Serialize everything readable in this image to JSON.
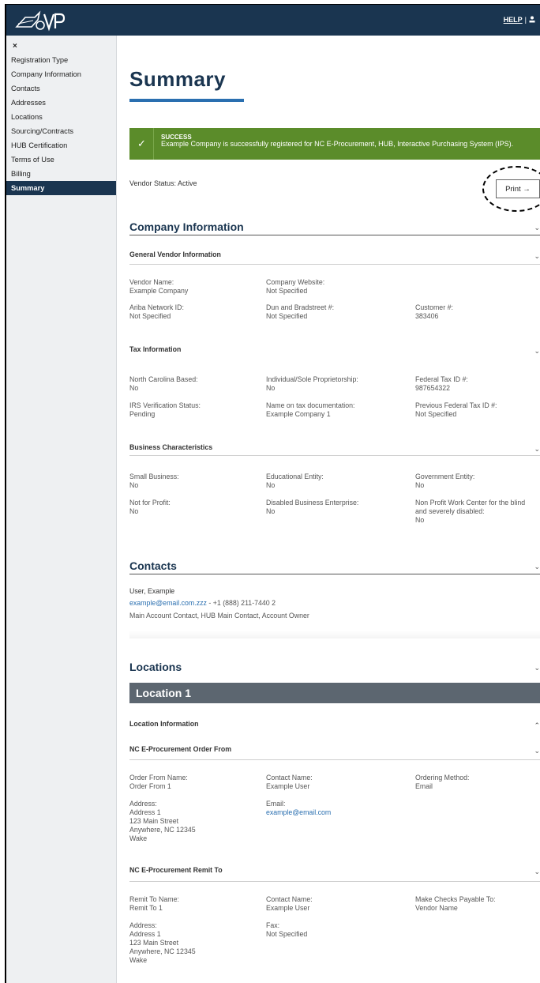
{
  "header": {
    "help_label": "HELP",
    "separator": "|"
  },
  "sidebar": {
    "close_label": "×",
    "items": [
      {
        "label": "Registration Type"
      },
      {
        "label": "Company Information"
      },
      {
        "label": "Contacts"
      },
      {
        "label": "Addresses"
      },
      {
        "label": "Locations"
      },
      {
        "label": "Sourcing/Contracts"
      },
      {
        "label": "HUB Certification"
      },
      {
        "label": "Terms of Use"
      },
      {
        "label": "Billing"
      },
      {
        "label": "Summary"
      }
    ]
  },
  "page": {
    "title": "Summary"
  },
  "alert": {
    "heading": "SUCCESS",
    "message": "Example Company is successfully registered for NC E-Procurement, HUB, Interactive Purchasing System (IPS)."
  },
  "status": {
    "text": "Vendor Status: Active",
    "print_label": "Print →"
  },
  "company": {
    "heading": "Company Information",
    "general": {
      "heading": "General Vendor Information",
      "vendor_name_label": "Vendor Name:",
      "vendor_name": "Example Company",
      "website_label": "Company Website:",
      "website": "Not Specified",
      "ariba_label": "Ariba Network ID:",
      "ariba": "Not Specified",
      "duns_label": "Dun and Bradstreet #:",
      "duns": "Not Specified",
      "customer_label": "Customer #:",
      "customer": "383406"
    },
    "tax": {
      "heading": "Tax Information",
      "nc_based_label": "North Carolina Based:",
      "nc_based": "No",
      "sole_label": "Individual/Sole Proprietorship:",
      "sole": "No",
      "fedtax_label": "Federal Tax ID #:",
      "fedtax": "987654322",
      "irs_label": "IRS Verification Status:",
      "irs": "Pending",
      "name_tax_label": "Name on tax documentation:",
      "name_tax": "Example Company 1",
      "prev_fedtax_label": "Previous Federal Tax ID #:",
      "prev_fedtax": "Not Specified"
    },
    "business": {
      "heading": "Business Characteristics",
      "small_label": "Small Business:",
      "small": "No",
      "edu_label": "Educational Entity:",
      "edu": "No",
      "gov_label": "Government Entity:",
      "gov": "No",
      "nfp_label": "Not for Profit:",
      "nfp": "No",
      "dbe_label": "Disabled Business Enterprise:",
      "dbe": "No",
      "npwc_label_1": "Non Profit Work Center for the blind",
      "npwc_label_2": "and severely disabled:",
      "npwc": "No"
    }
  },
  "contacts": {
    "heading": "Contacts",
    "name": "User, Example",
    "email": "example@email.com.zzz",
    "phone": " - +1 (888) 211-7440 2",
    "roles": "Main Account Contact, HUB Main Contact, Account Owner"
  },
  "locations": {
    "heading": "Locations",
    "location_title": "Location 1",
    "info_heading": "Location Information",
    "order_from": {
      "heading": "NC E-Procurement Order From",
      "name_label": "Order From Name:",
      "name": "Order From 1",
      "contact_label": "Contact Name:",
      "contact": "Example User",
      "method_label": "Ordering Method:",
      "method": "Email",
      "address_label": "Address:",
      "address_lines": [
        "Address 1",
        "123 Main Street",
        "Anywhere, NC 12345",
        "Wake"
      ],
      "email_label": "Email:",
      "email": "example@email.com"
    },
    "remit_to": {
      "heading": "NC E-Procurement Remit To",
      "name_label": "Remit To Name:",
      "name": "Remit To 1",
      "contact_label": "Contact Name:",
      "contact": "Example User",
      "checks_label": "Make Checks Payable To:",
      "checks": "Vendor Name",
      "address_label": "Address:",
      "address_lines": [
        "Address 1",
        "123 Main Street",
        "Anywhere, NC 12345",
        "Wake"
      ],
      "fax_label": "Fax:",
      "fax": "Not Specified"
    }
  }
}
